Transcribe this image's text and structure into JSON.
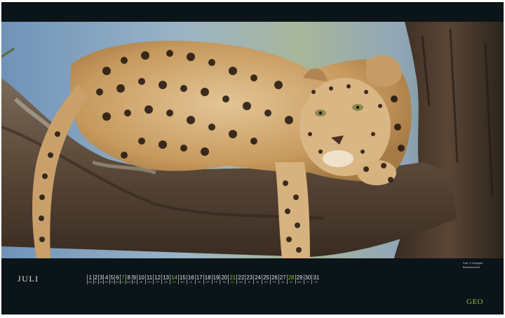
{
  "month": "JULI",
  "days": [
    {
      "n": "1",
      "wd": "MO"
    },
    {
      "n": "2",
      "wd": "DI"
    },
    {
      "n": "3",
      "wd": "MI"
    },
    {
      "n": "4",
      "wd": "DO"
    },
    {
      "n": "5",
      "wd": "FR"
    },
    {
      "n": "6",
      "wd": "SA"
    },
    {
      "n": "7",
      "wd": "SO",
      "sunday": true
    },
    {
      "n": "8",
      "wd": "MO"
    },
    {
      "n": "9",
      "wd": "DI"
    },
    {
      "n": "10",
      "wd": "MI"
    },
    {
      "n": "11",
      "wd": "DO"
    },
    {
      "n": "12",
      "wd": "FR"
    },
    {
      "n": "13",
      "wd": "SA"
    },
    {
      "n": "14",
      "wd": "SO",
      "sunday": true
    },
    {
      "n": "15",
      "wd": "MO"
    },
    {
      "n": "16",
      "wd": "DI"
    },
    {
      "n": "17",
      "wd": "MI"
    },
    {
      "n": "18",
      "wd": "DO"
    },
    {
      "n": "19",
      "wd": "FR"
    },
    {
      "n": "20",
      "wd": "SA"
    },
    {
      "n": "21",
      "wd": "SO",
      "sunday": true
    },
    {
      "n": "22",
      "wd": "MO"
    },
    {
      "n": "23",
      "wd": "DI"
    },
    {
      "n": "24",
      "wd": "MI"
    },
    {
      "n": "25",
      "wd": "DO"
    },
    {
      "n": "26",
      "wd": "FR"
    },
    {
      "n": "27",
      "wd": "SA"
    },
    {
      "n": "28",
      "wd": "SO",
      "sunday": true
    },
    {
      "n": "29",
      "wd": "MO"
    },
    {
      "n": "30",
      "wd": "DI"
    },
    {
      "n": "31",
      "wd": "MI"
    }
  ],
  "credits": {
    "line1": "Foto: © Copyright",
    "line2": "Bildunterschrift"
  },
  "logo": "GEO",
  "colors": {
    "background": "#0b1418",
    "accent_green": "#8cbf3a",
    "text": "#e6e6e6"
  }
}
